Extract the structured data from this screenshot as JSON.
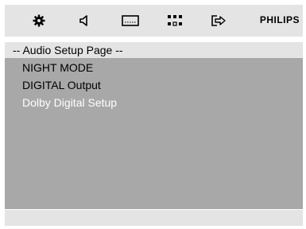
{
  "topbar": {
    "tabs": [
      {
        "icon": "gear-icon"
      },
      {
        "icon": "speaker-icon"
      },
      {
        "icon": "display-icon"
      },
      {
        "icon": "grid-icon"
      },
      {
        "icon": "exit-icon"
      }
    ],
    "brand": "PHILIPS"
  },
  "page_header": "-- Audio Setup Page --",
  "menu": {
    "items": [
      {
        "label": "NIGHT MODE"
      },
      {
        "label": "DIGITAL Output"
      },
      {
        "label": "Dolby Digital Setup",
        "selected": true
      }
    ]
  },
  "colors": {
    "bar_background": "#e4e4e4",
    "menu_background": "#a8a8a8",
    "selected_text": "#ffffff",
    "text": "#000000"
  }
}
